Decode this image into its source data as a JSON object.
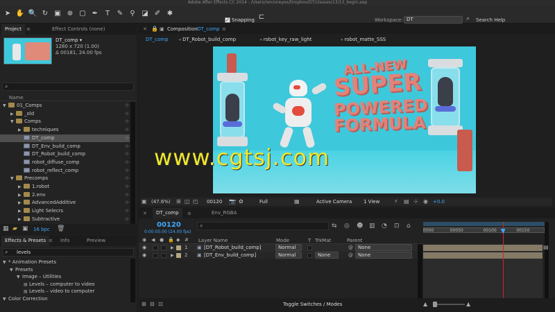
{
  "title_bar": "Adobe After Effects CC 2014 - /Users/renzoreyes/Dropbox/DT/classes/13/13_begin.aep",
  "toolbar": {
    "snapping_label": "Snapping",
    "workspace_label": "Workspace:",
    "workspace_value": "DT",
    "search_help": "Search Help"
  },
  "project": {
    "tab_project": "Project",
    "tab_effect_controls": "Effect Controls (none)",
    "selected_name": "DT_comp ▾",
    "selected_dims": "1280 x 720 (1.00)",
    "selected_duration": "Δ 00181, 24.00 fps",
    "search_icon": "search-icon",
    "column_name": "Name",
    "items": [
      {
        "label": "01_Comps",
        "type": "folder",
        "indent": 0,
        "open": true
      },
      {
        "label": "_old",
        "type": "folder",
        "indent": 1,
        "open": false
      },
      {
        "label": "Comps",
        "type": "folder",
        "indent": 1,
        "open": true
      },
      {
        "label": "techniques",
        "type": "folder",
        "indent": 2,
        "open": false
      },
      {
        "label": "DT_comp",
        "type": "comp",
        "indent": 2,
        "selected": true
      },
      {
        "label": "DT_Env_build_comp",
        "type": "comp",
        "indent": 2
      },
      {
        "label": "DT_Robot_build_comp",
        "type": "comp",
        "indent": 2
      },
      {
        "label": "robot_diffuse_comp",
        "type": "comp",
        "indent": 2
      },
      {
        "label": "robot_reflect_comp",
        "type": "comp",
        "indent": 2
      },
      {
        "label": "Precomps",
        "type": "folder",
        "indent": 1,
        "open": true
      },
      {
        "label": "1.robot",
        "type": "folder",
        "indent": 2,
        "open": false
      },
      {
        "label": "2.env",
        "type": "folder",
        "indent": 2,
        "open": false
      },
      {
        "label": "AdvancedAdditive",
        "type": "folder",
        "indent": 2,
        "open": false
      },
      {
        "label": "Light Selecrs",
        "type": "folder",
        "indent": 2,
        "open": false
      },
      {
        "label": "Subtractive",
        "type": "folder",
        "indent": 2,
        "open": false
      }
    ],
    "bpc": "16 bpc"
  },
  "effects": {
    "tab_effects": "Effects & Presets",
    "tab_info": "Info",
    "tab_preview": "Preview",
    "search_value": "levels",
    "tree": [
      {
        "label": "* Animation Presets",
        "indent": 0
      },
      {
        "label": "Presets",
        "indent": 1
      },
      {
        "label": "Image – Utilities",
        "indent": 2
      },
      {
        "label": "Levels – computer to video",
        "indent": 3
      },
      {
        "label": "Levels – video to computer",
        "indent": 3
      },
      {
        "label": "Color Correction",
        "indent": 0
      }
    ]
  },
  "composition": {
    "panel_label": "Composition",
    "panel_comp": "DT_comp",
    "breadcrumbs": [
      "DT_comp",
      "DT_Robot_build_comp",
      "robot_key_raw_light",
      "robot_matte_SSS"
    ],
    "headline": [
      "ALL-NEW",
      "SUPER",
      "POWERED",
      "FORMULA"
    ],
    "watermark": "www.cgtsj.com",
    "zoom": "(47.6%)",
    "timecode": "00120",
    "resolution": "Full",
    "camera": "Active Camera",
    "view": "1 View",
    "exposure": "+0.0"
  },
  "timeline": {
    "tab_comp": "DT_comp",
    "tab_env": "Env_RGBA",
    "timecode": "00120",
    "timecode_sub": "0:00:05:00 (24.00 fps)",
    "columns": {
      "layer_name": "Layer Name",
      "mode": "Mode",
      "t": "T",
      "trkmat": "TrkMat",
      "parent": "Parent"
    },
    "layers": [
      {
        "num": "1",
        "name": "[DT_Robot_build_comp]",
        "mode": "Normal",
        "trkmat": "",
        "parent": "None",
        "color": "#b5a783"
      },
      {
        "num": "2",
        "name": "[DT_Env_build_comp]",
        "mode": "Normal",
        "trkmat": "None",
        "parent": "None",
        "color": "#b5a783"
      }
    ],
    "ruler": [
      "0000",
      "00050",
      "00100",
      "00150"
    ],
    "current_frame": 120,
    "frame_range": [
      0,
      180
    ],
    "toggle_label": "Toggle Switches / Modes"
  },
  "colors": {
    "accent_blue": "#3ea8ff",
    "bg_panel": "#232323",
    "layer_bar": "#847a66",
    "playhead": "#d2232a"
  }
}
